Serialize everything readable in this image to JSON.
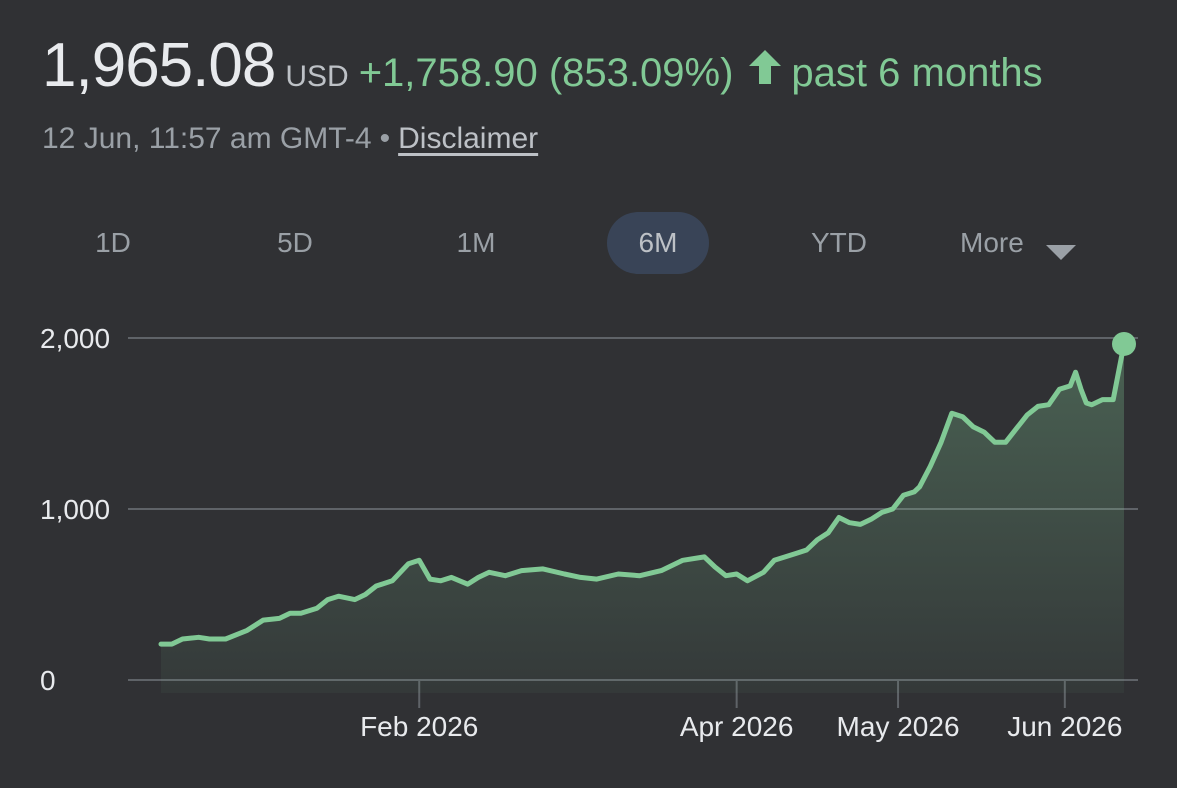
{
  "header": {
    "price": "1,965.08",
    "currency": "USD",
    "change": "+1,758.90 (853.09%)",
    "arrow_icon": "arrow-up-icon",
    "period": "past 6 months",
    "timestamp": "12 Jun, 11:57 am GMT-4",
    "separator": "•",
    "disclaimer": "Disclaimer"
  },
  "ranges": [
    {
      "label": "1D",
      "active": false
    },
    {
      "label": "5D",
      "active": false
    },
    {
      "label": "1M",
      "active": false
    },
    {
      "label": "6M",
      "active": true
    },
    {
      "label": "YTD",
      "active": false
    }
  ],
  "more": {
    "label": "More",
    "icon": "caret-down-icon"
  },
  "colors": {
    "background": "#303134",
    "line": "#81c995",
    "positive": "#81c995",
    "gridline": "#5f6368",
    "active_range_bg": "#394457"
  },
  "chart_data": {
    "type": "area",
    "ylim": [
      0,
      2000
    ],
    "yticks": [
      {
        "value": 0,
        "label": "0"
      },
      {
        "value": 1000,
        "label": "1,000"
      },
      {
        "value": 2000,
        "label": "2,000"
      }
    ],
    "xticks": [
      {
        "date": "2026-02-01",
        "label": "Feb 2026"
      },
      {
        "date": "2026-04-01",
        "label": "Apr 2026"
      },
      {
        "date": "2026-05-01",
        "label": "May 2026"
      },
      {
        "date": "2026-06-01",
        "label": "Jun 2026"
      }
    ],
    "grid": true,
    "last_point_marker": true,
    "series": [
      {
        "x": [
          "2025-12-15",
          "2025-12-17",
          "2025-12-19",
          "2025-12-22",
          "2025-12-24",
          "2025-12-27",
          "2025-12-31",
          "2026-01-03",
          "2026-01-06",
          "2026-01-08",
          "2026-01-10",
          "2026-01-13",
          "2026-01-15",
          "2026-01-17",
          "2026-01-20",
          "2026-01-22",
          "2026-01-24",
          "2026-01-27",
          "2026-01-30",
          "2026-02-01",
          "2026-02-03",
          "2026-02-05",
          "2026-02-07",
          "2026-02-10",
          "2026-02-12",
          "2026-02-14",
          "2026-02-17",
          "2026-02-20",
          "2026-02-24",
          "2026-02-28",
          "2026-03-03",
          "2026-03-06",
          "2026-03-10",
          "2026-03-14",
          "2026-03-18",
          "2026-03-22",
          "2026-03-26",
          "2026-03-28",
          "2026-03-30",
          "2026-04-01",
          "2026-04-03",
          "2026-04-06",
          "2026-04-08",
          "2026-04-10",
          "2026-04-12",
          "2026-04-14",
          "2026-04-16",
          "2026-04-18",
          "2026-04-20",
          "2026-04-22",
          "2026-04-24",
          "2026-04-26",
          "2026-04-28",
          "2026-04-30",
          "2026-05-02",
          "2026-05-04",
          "2026-05-05",
          "2026-05-07",
          "2026-05-09",
          "2026-05-11",
          "2026-05-13",
          "2026-05-15",
          "2026-05-17",
          "2026-05-19",
          "2026-05-21",
          "2026-05-23",
          "2026-05-25",
          "2026-05-27",
          "2026-05-29",
          "2026-05-31",
          "2026-06-02",
          "2026-06-03",
          "2026-06-04",
          "2026-06-05",
          "2026-06-06",
          "2026-06-08",
          "2026-06-10",
          "2026-06-12"
        ],
        "y": [
          210,
          210,
          240,
          250,
          240,
          240,
          290,
          350,
          360,
          390,
          390,
          420,
          470,
          490,
          470,
          500,
          550,
          580,
          680,
          700,
          590,
          580,
          600,
          560,
          600,
          630,
          610,
          640,
          650,
          620,
          600,
          590,
          620,
          610,
          640,
          700,
          720,
          660,
          610,
          620,
          580,
          630,
          700,
          720,
          740,
          760,
          820,
          860,
          950,
          920,
          910,
          940,
          980,
          1000,
          1080,
          1100,
          1130,
          1250,
          1390,
          1560,
          1540,
          1480,
          1450,
          1390,
          1390,
          1470,
          1550,
          1600,
          1610,
          1700,
          1720,
          1800,
          1700,
          1620,
          1610,
          1640,
          1640,
          1965.08
        ]
      }
    ]
  }
}
